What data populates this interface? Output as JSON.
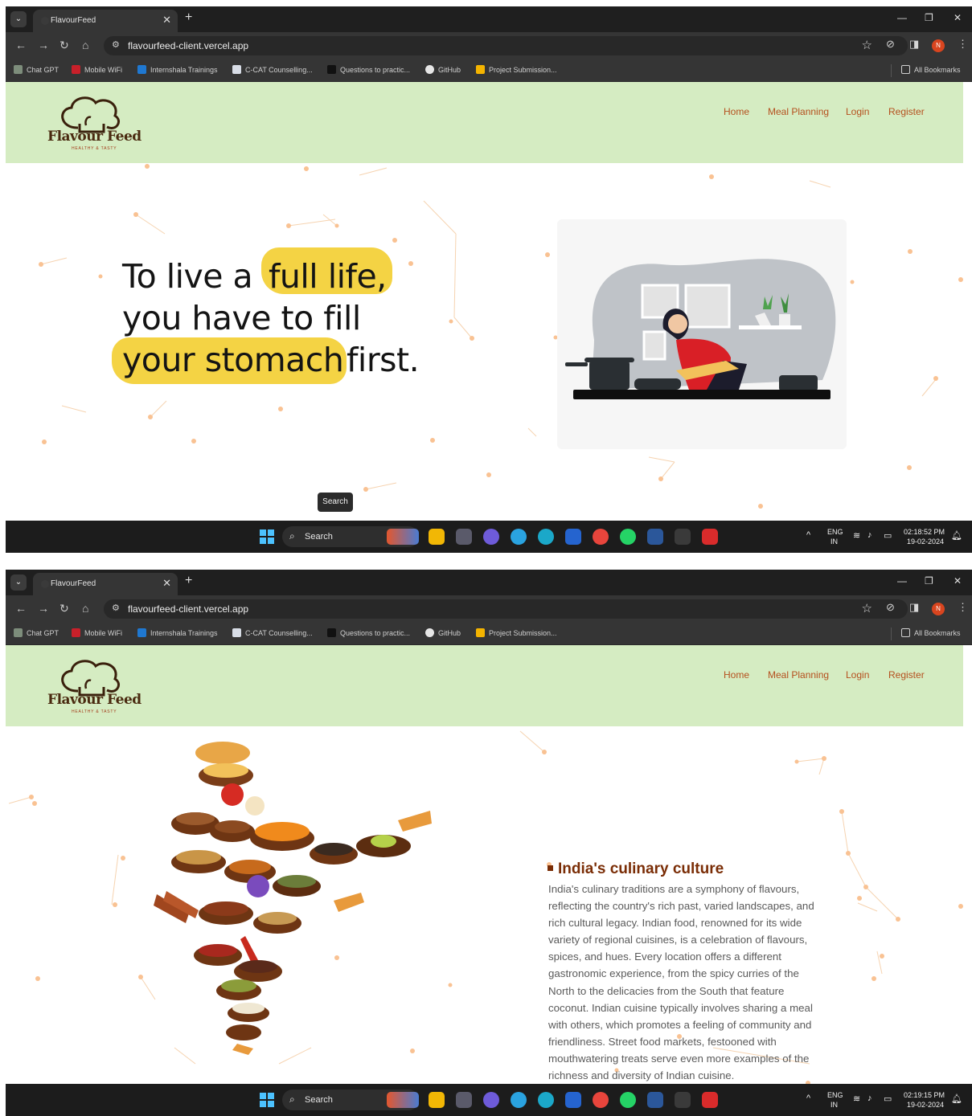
{
  "browser": {
    "tab_title": "FlavourFeed",
    "url": "flavourfeed-client.vercel.app",
    "profile_initial": "N",
    "bookmarks": [
      "Chat GPT",
      "Mobile WiFi",
      "Internshala Trainings",
      "C-CAT Counselling...",
      "Questions to practic...",
      "GitHub",
      "Project Submission..."
    ],
    "all_bookmarks": "All Bookmarks"
  },
  "site": {
    "brand": "Flavour Feed",
    "tagline": "HEALTHY & TASTY",
    "nav": [
      "Home",
      "Meal Planning",
      "Login",
      "Register"
    ],
    "nav_color": "#b5501e",
    "header_bg": "#d5ecc2"
  },
  "hero": {
    "line1_a": "To live a",
    "line1_b": "full life,",
    "line2": "you have to fill",
    "line3_a": "your stomach",
    "line3_b": "first.",
    "highlight_color": "#f3d13a"
  },
  "tooltip": "Search",
  "culture": {
    "title": "India's culinary culture",
    "body": "India's culinary traditions are a symphony of flavours, reflecting the country's rich past, varied landscapes, and rich cultural legacy. Indian food, renowned for its wide variety of regional cuisines, is a celebration of flavours, spices, and hues. Every location offers a different gastronomic experience, from the spicy curries of the North to the delicacies from the South that feature coconut. Indian cuisine typically involves sharing a meal with others, which promotes a feeling of community and friendliness. Street food markets, festooned with mouthwatering treats serve even more examples of the richness and diversity of Indian cuisine."
  },
  "taskbar": {
    "search": "Search",
    "lang1": "ENG",
    "lang2": "IN",
    "shot1": {
      "time": "02:18:52 PM",
      "date": "19-02-2024"
    },
    "shot2": {
      "time": "02:19:15 PM",
      "date": "19-02-2024"
    }
  }
}
